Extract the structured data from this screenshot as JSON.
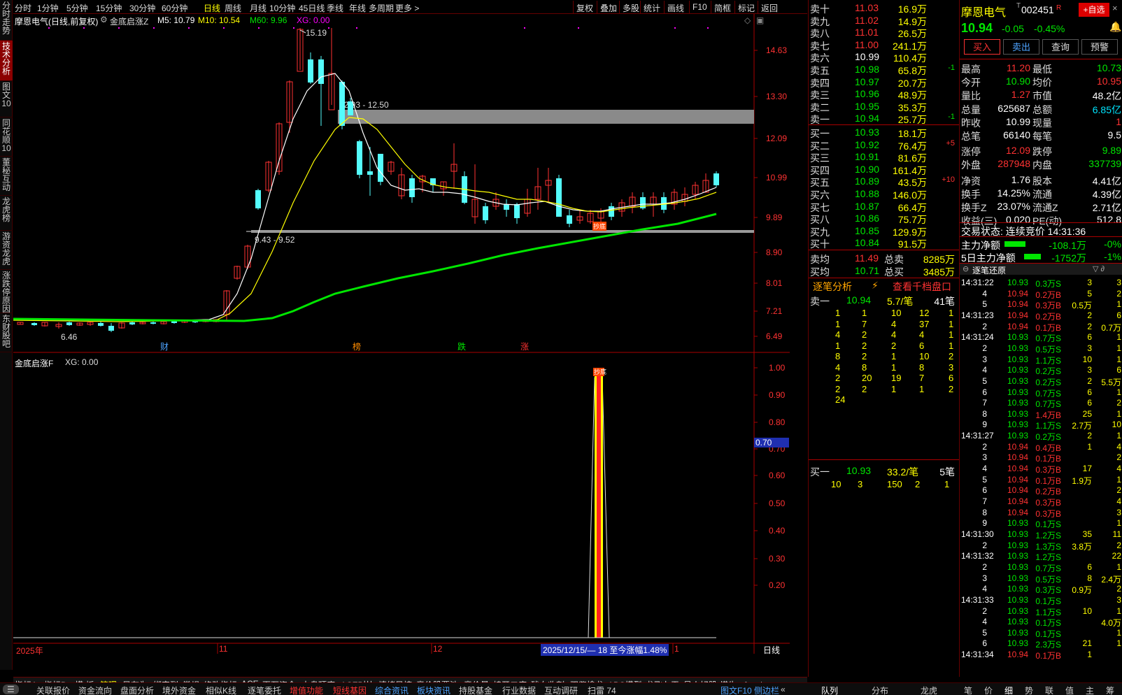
{
  "left_tabs": [
    "分时走势",
    "技术分析",
    "图文10",
    "同花顺10",
    "董秘互动",
    "龙虎榜",
    "游资龙虎",
    "涨跌停原因",
    "东财股吧"
  ],
  "period_tabs": [
    "分时",
    "1分钟",
    "5分钟",
    "15分钟",
    "30分钟",
    "60分钟",
    "日线",
    "周线",
    "月线",
    "10分钟",
    "45日线",
    "季线",
    "年线",
    "多周期",
    "更多 >"
  ],
  "toolbar_right": [
    "复权",
    "叠加",
    "多股",
    "统计",
    "画线",
    "F10",
    "简框",
    "标记",
    "返回"
  ],
  "chart": {
    "title": "摩恩电气(日线,前复权)",
    "indicator": "金底启涨Z",
    "ma5": "M5: 10.79",
    "ma10": "M10: 10.54",
    "ma60": "M60: 9.96",
    "xg": "XG: 0.00",
    "yticks": [
      "14.63",
      "13.30",
      "12.09",
      "10.99",
      "9.89",
      "8.90",
      "8.01",
      "7.21",
      "6.49"
    ],
    "high_label": "15.19",
    "low_label": "6.46",
    "box1_label": "12.93 - 12.50",
    "box2_label": "9.43 - 9.52",
    "markers": [
      "财",
      "榜",
      "跌",
      "涨"
    ],
    "marker_colors": [
      "#4da3ff",
      "#ff8c00",
      "#00e600",
      "#ff3232"
    ],
    "xlabels": [
      "2025年",
      "11",
      "12",
      "1"
    ],
    "date_range": "2025/12/15/— 18 至今涨幅1.48%",
    "right_label": "日线",
    "signal_tag": "抄底"
  },
  "subchart": {
    "title": "金底启涨F",
    "xg": "XG: 0.00",
    "yticks": [
      "1.00",
      "0.90",
      "0.80",
      "0.70",
      "0.60",
      "0.50",
      "0.40",
      "0.30",
      "0.20"
    ],
    "cursor": "0.70"
  },
  "bottom_tabs": [
    "指标A",
    "指标B",
    "模 板",
    "管理",
    "另存为",
    "绑定到",
    "常规",
    "修改指标",
    "ACE",
    "百万资金",
    "大盘顶底",
    "ACE对比",
    "情绪风控",
    "竞价股票池",
    "竞价量",
    "椅开二度",
    "残血收割",
    "双紫擒龙",
    "ABC模型",
    "龙飞九天",
    "号人好股",
    "懂牛"
  ],
  "status_bar": [
    "关联报价",
    "资金流向",
    "盘面分析",
    "境外资金",
    "相似K线",
    "逐笔委托",
    "增值功能",
    "短线基因",
    "综合资讯",
    "板块资讯",
    "持股基金",
    "行业数据",
    "互动调研",
    "扫雷 74"
  ],
  "status_right": "图文F10 侧边栏",
  "order_book": {
    "sells": [
      [
        "卖十",
        "11.03",
        "16.9万",
        ""
      ],
      [
        "卖九",
        "11.02",
        "14.9万",
        ""
      ],
      [
        "卖八",
        "11.01",
        "26.5万",
        ""
      ],
      [
        "卖七",
        "11.00",
        "241.1万",
        ""
      ],
      [
        "卖六",
        "10.99",
        "110.4万",
        ""
      ],
      [
        "卖五",
        "10.98",
        "65.8万",
        "-1"
      ],
      [
        "卖四",
        "10.97",
        "20.7万",
        ""
      ],
      [
        "卖三",
        "10.96",
        "48.9万",
        ""
      ],
      [
        "卖二",
        "10.95",
        "35.3万",
        ""
      ],
      [
        "卖一",
        "10.94",
        "25.7万",
        "-1"
      ]
    ],
    "buys": [
      [
        "买一",
        "10.93",
        "18.1万",
        ""
      ],
      [
        "买二",
        "10.92",
        "76.4万",
        "+5"
      ],
      [
        "买三",
        "10.91",
        "81.6万",
        ""
      ],
      [
        "买四",
        "10.90",
        "161.4万",
        ""
      ],
      [
        "买五",
        "10.89",
        "43.5万",
        "+10"
      ],
      [
        "买六",
        "10.88",
        "146.0万",
        ""
      ],
      [
        "买七",
        "10.87",
        "66.4万",
        ""
      ],
      [
        "买八",
        "10.86",
        "75.7万",
        ""
      ],
      [
        "买九",
        "10.85",
        "129.9万",
        ""
      ],
      [
        "买十",
        "10.84",
        "91.5万",
        ""
      ]
    ],
    "avg": [
      [
        "卖均",
        "11.49",
        "总卖",
        "8285万"
      ],
      [
        "买均",
        "10.71",
        "总买",
        "3485万"
      ]
    ],
    "analysis_title": "逐笔分析",
    "analysis_link": "查看千档盘口",
    "sell1": {
      "label": "卖一",
      "price": "10.94",
      "per": "5.7/笔",
      "count": "41笔"
    },
    "sell_grid": [
      [
        "1",
        "1",
        "10",
        "12",
        "1"
      ],
      [
        "1",
        "7",
        "4",
        "37",
        "1"
      ],
      [
        "4",
        "2",
        "4",
        "4",
        "1"
      ],
      [
        "1",
        "2",
        "2",
        "6",
        "1"
      ],
      [
        "8",
        "2",
        "1",
        "10",
        "2"
      ],
      [
        "4",
        "8",
        "1",
        "8",
        "3"
      ],
      [
        "2",
        "20",
        "19",
        "7",
        "6"
      ],
      [
        "2",
        "2",
        "1",
        "1",
        "2"
      ],
      [
        "24",
        "",
        "",
        "",
        ""
      ]
    ],
    "buy1": {
      "label": "买一",
      "price": "10.93",
      "per": "33.2/笔",
      "count": "5笔"
    },
    "buy_grid": [
      [
        "10",
        "3",
        "150",
        "2",
        "1"
      ]
    ],
    "tabs": [
      "队列",
      "分布",
      "龙虎"
    ]
  },
  "quote": {
    "name": "摩恩电气",
    "code": "002451",
    "r": "R",
    "add": "+自选",
    "price": "10.94",
    "change": "-0.05",
    "pct": "-0.45%",
    "buttons": [
      "买入",
      "卖出",
      "查询",
      "预警"
    ],
    "rows": [
      [
        "最高",
        "11.20",
        "最低",
        "10.73"
      ],
      [
        "今开",
        "10.90",
        "均价",
        "10.95"
      ],
      [
        "量比",
        "1.27",
        "市值",
        "48.2亿"
      ],
      [
        "总量",
        "625687",
        "总额",
        "6.85亿"
      ],
      [
        "昨收",
        "10.99",
        "现量",
        "1"
      ],
      [
        "总笔",
        "66140",
        "每笔",
        "9.5"
      ],
      [
        "涨停",
        "12.09",
        "跌停",
        "9.89"
      ],
      [
        "外盘",
        "287948",
        "内盘",
        "337739"
      ],
      [
        "净资",
        "1.76",
        "股本",
        "4.41亿"
      ],
      [
        "换手",
        "14.25%",
        "流通",
        "4.39亿"
      ],
      [
        "换手Z",
        "23.07%",
        "流通Z",
        "2.71亿"
      ],
      [
        "收益(三)",
        "0.020",
        "PE(动)",
        "512.8"
      ]
    ],
    "trade_status": "交易状态: 连续竞价 14:31:36",
    "main_flow": [
      "主力净额",
      "-108.1万",
      "-0%"
    ],
    "flow5": [
      "5日主力净额",
      "-1752万",
      "-1%"
    ],
    "ticks_title": "逐笔还原",
    "ticks": [
      [
        "14:31:22",
        "10.93",
        "0.3万S",
        "3",
        "3"
      ],
      [
        "4",
        "10.94",
        "0.2万B",
        "5",
        "2"
      ],
      [
        "5",
        "10.94",
        "0.3万B",
        "0.5万",
        "1"
      ],
      [
        "14:31:23",
        "10.94",
        "0.2万B",
        "2",
        "6"
      ],
      [
        "2",
        "10.94",
        "0.1万B",
        "2",
        "0.7万"
      ],
      [
        "14:31:24",
        "10.93",
        "0.7万S",
        "6",
        "1"
      ],
      [
        "2",
        "10.93",
        "0.5万S",
        "3",
        "1"
      ],
      [
        "3",
        "10.93",
        "1.1万S",
        "10",
        "1"
      ],
      [
        "4",
        "10.93",
        "0.2万S",
        "3",
        "6"
      ],
      [
        "5",
        "10.93",
        "0.2万S",
        "2",
        "5.5万"
      ],
      [
        "6",
        "10.93",
        "0.7万S",
        "6",
        "1"
      ],
      [
        "7",
        "10.93",
        "0.7万S",
        "6",
        "2"
      ],
      [
        "8",
        "10.93",
        "1.4万B",
        "25",
        "1"
      ],
      [
        "9",
        "10.93",
        "1.1万S",
        "2.7万",
        "10"
      ],
      [
        "14:31:27",
        "10.93",
        "0.2万S",
        "2",
        "1"
      ],
      [
        "2",
        "10.94",
        "0.4万B",
        "1",
        "4"
      ],
      [
        "3",
        "10.94",
        "0.1万B",
        "",
        "2"
      ],
      [
        "4",
        "10.94",
        "0.3万B",
        "17",
        "4"
      ],
      [
        "5",
        "10.94",
        "0.1万B",
        "1.9万",
        "1"
      ],
      [
        "6",
        "10.94",
        "0.2万B",
        "",
        "2"
      ],
      [
        "7",
        "10.94",
        "0.3万B",
        "",
        "4"
      ],
      [
        "8",
        "10.94",
        "0.3万B",
        "",
        "3"
      ],
      [
        "9",
        "10.93",
        "0.1万S",
        "",
        "1"
      ],
      [
        "14:31:30",
        "10.93",
        "1.2万S",
        "35",
        "11"
      ],
      [
        "2",
        "10.93",
        "1.3万S",
        "3.8万",
        "2"
      ],
      [
        "14:31:32",
        "10.93",
        "1.2万S",
        "",
        "22"
      ],
      [
        "2",
        "10.93",
        "0.7万S",
        "6",
        "1"
      ],
      [
        "3",
        "10.93",
        "0.5万S",
        "8",
        "2.4万"
      ],
      [
        "4",
        "10.93",
        "0.3万S",
        "0.9万",
        "2"
      ],
      [
        "14:31:33",
        "10.93",
        "0.1万S",
        "",
        "3"
      ],
      [
        "2",
        "10.93",
        "1.1万S",
        "10",
        "1"
      ],
      [
        "4",
        "10.93",
        "0.1万S",
        "",
        "4.0万"
      ],
      [
        "5",
        "10.93",
        "0.1万S",
        "",
        "1"
      ],
      [
        "6",
        "10.93",
        "2.3万S",
        "21",
        "1"
      ],
      [
        "14:31:34",
        "10.94",
        "0.1万B",
        "1",
        ""
      ]
    ],
    "bottom_tabs": [
      "笔",
      "价",
      "细",
      "势",
      "联",
      "值",
      "主",
      "筹"
    ]
  }
}
